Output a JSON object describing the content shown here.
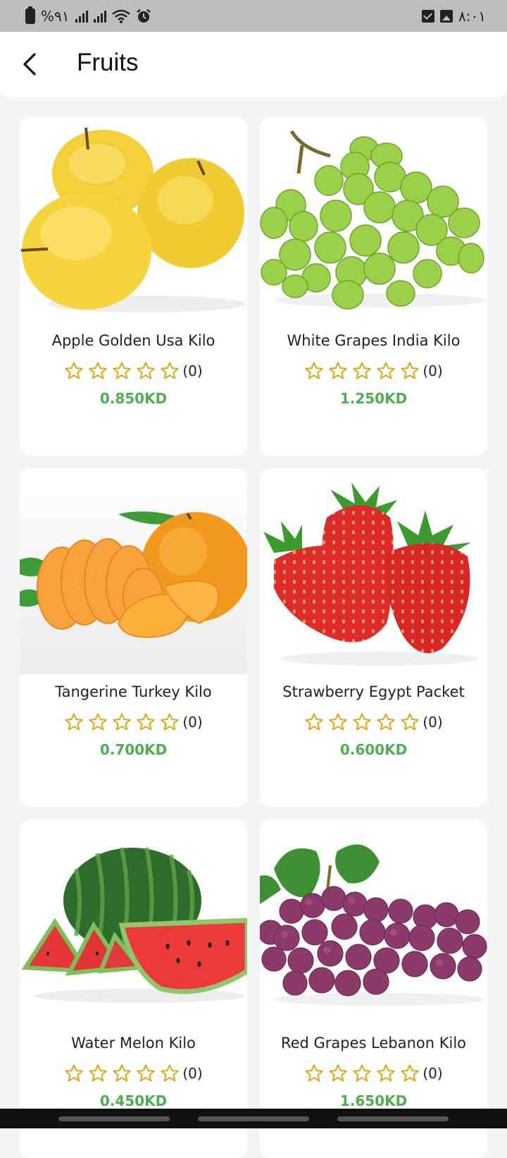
{
  "status_bar": {
    "battery_text": "%۹۱",
    "time": "۸:۰۱"
  },
  "header": {
    "title": "Fruits",
    "back_icon": "chevron-left-icon"
  },
  "products": [
    {
      "name": "Apple Golden Usa Kilo",
      "rating": 0,
      "rating_count": "(0)",
      "price": "0.850KD",
      "image": "golden-apples"
    },
    {
      "name": "White Grapes India Kilo",
      "rating": 0,
      "rating_count": "(0)",
      "price": "1.250KD",
      "image": "green-grapes"
    },
    {
      "name": "Tangerine Turkey Kilo",
      "rating": 0,
      "rating_count": "(0)",
      "price": "0.700KD",
      "image": "tangerine"
    },
    {
      "name": "Strawberry Egypt Packet",
      "rating": 0,
      "rating_count": "(0)",
      "price": "0.600KD",
      "image": "strawberries"
    },
    {
      "name": "Water Melon Kilo",
      "rating": 0,
      "rating_count": "(0)",
      "price": "0.450KD",
      "image": "watermelon"
    },
    {
      "name": "Red Grapes Lebanon Kilo",
      "rating": 0,
      "rating_count": "(0)",
      "price": "1.650KD",
      "image": "red-grapes"
    }
  ],
  "colors": {
    "price": "#4caf50",
    "star_outline": "#e0a100",
    "background": "#f5f5f5"
  }
}
